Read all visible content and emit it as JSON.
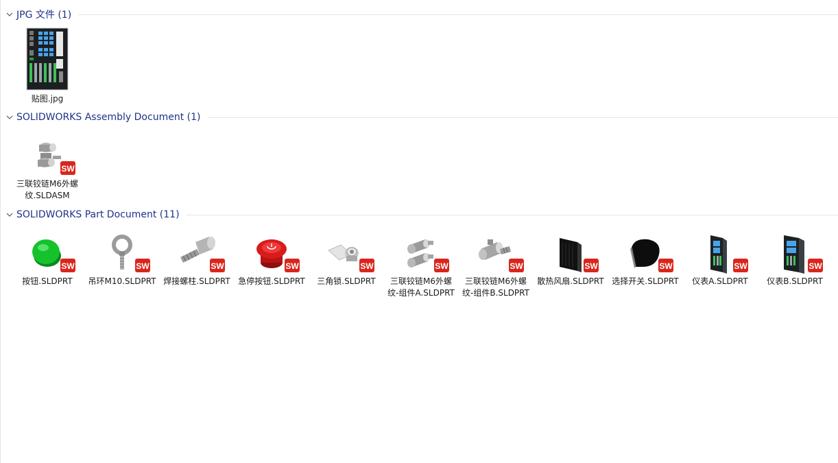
{
  "groups": [
    {
      "title": "JPG 文件 (1)",
      "items": [
        {
          "name": "贴图.jpg",
          "icon": "control-panel-image-icon"
        }
      ]
    },
    {
      "title": "SOLIDWORKS Assembly Document (1)",
      "items": [
        {
          "name": "三联铰链M6外螺纹.SLDASM",
          "icon": "hinge-assembly-icon"
        }
      ]
    },
    {
      "title": "SOLIDWORKS Part Document (11)",
      "items": [
        {
          "name": "按钮.SLDPRT",
          "icon": "green-button-icon"
        },
        {
          "name": "吊环M10.SLDPRT",
          "icon": "eye-bolt-icon"
        },
        {
          "name": "焊接螺柱.SLDPRT",
          "icon": "weld-stud-icon"
        },
        {
          "name": "急停按钮.SLDPRT",
          "icon": "emergency-stop-icon"
        },
        {
          "name": "三角锁.SLDPRT",
          "icon": "triangle-lock-icon"
        },
        {
          "name": "三联铰链M6外螺纹-组件A.SLDPRT",
          "icon": "hinge-part-a-icon"
        },
        {
          "name": "三联铰链M6外螺纹-组件B.SLDPRT",
          "icon": "hinge-part-b-icon"
        },
        {
          "name": "散热风扇.SLDPRT",
          "icon": "cooling-fan-icon"
        },
        {
          "name": "选择开关.SLDPRT",
          "icon": "selector-switch-icon"
        },
        {
          "name": "仪表A.SLDPRT",
          "icon": "meter-a-icon"
        },
        {
          "name": "仪表B.SLDPRT",
          "icon": "meter-b-icon"
        }
      ]
    }
  ],
  "colors": {
    "header_text": "#1e3287",
    "sw_badge": "#d9261c"
  }
}
